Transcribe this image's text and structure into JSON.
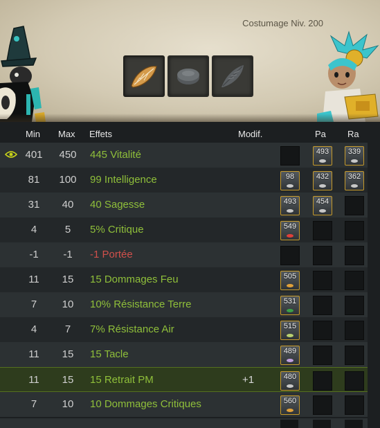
{
  "banner": {
    "title": "Costumage Niv. 200"
  },
  "slots": [
    {
      "icon": "rune-leaf-icon",
      "active": true
    },
    {
      "icon": "stone-icon",
      "active": false
    },
    {
      "icon": "feather-icon",
      "active": false
    }
  ],
  "headers": {
    "min": "Min",
    "max": "Max",
    "effects": "Effets",
    "modif": "Modif.",
    "pa": "Pa",
    "ra": "Ra"
  },
  "rows": [
    {
      "min": "401",
      "max": "450",
      "effect": "445 Vitalité",
      "color": "green",
      "modif": "",
      "eye": true,
      "r1": {
        "num": "",
        "filled": false
      },
      "r2": {
        "num": "493",
        "filled": true,
        "gem": "#c8c8c8"
      },
      "r3": {
        "num": "339",
        "filled": true,
        "gem": "#c8c8c8"
      }
    },
    {
      "min": "81",
      "max": "100",
      "effect": "99 Intelligence",
      "color": "green",
      "modif": "",
      "eye": false,
      "r1": {
        "num": "98",
        "filled": true,
        "gem": "#c8c8c8"
      },
      "r2": {
        "num": "432",
        "filled": true,
        "gem": "#c8c8c8"
      },
      "r3": {
        "num": "362",
        "filled": true,
        "gem": "#c8c8c8"
      }
    },
    {
      "min": "31",
      "max": "40",
      "effect": "40 Sagesse",
      "color": "green",
      "modif": "",
      "eye": false,
      "r1": {
        "num": "493",
        "filled": true,
        "gem": "#c8c8c8"
      },
      "r2": {
        "num": "454",
        "filled": true,
        "gem": "#c8c8c8"
      },
      "r3": {
        "num": "",
        "filled": false
      }
    },
    {
      "min": "4",
      "max": "5",
      "effect": "5% Critique",
      "color": "green",
      "modif": "",
      "eye": false,
      "r1": {
        "num": "549",
        "filled": true,
        "gem": "#e0403a"
      },
      "r2": {
        "num": "",
        "filled": false
      },
      "r3": {
        "num": "",
        "filled": false
      }
    },
    {
      "min": "-1",
      "max": "-1",
      "effect": "-1 Portée",
      "color": "red",
      "modif": "",
      "eye": false,
      "r1": {
        "num": "",
        "filled": false
      },
      "r2": {
        "num": "",
        "filled": false
      },
      "r3": {
        "num": "",
        "filled": false
      }
    },
    {
      "min": "11",
      "max": "15",
      "effect": "15 Dommages Feu",
      "color": "green",
      "modif": "",
      "eye": false,
      "r1": {
        "num": "505",
        "filled": true,
        "gem": "#e0a03a"
      },
      "r2": {
        "num": "",
        "filled": false
      },
      "r3": {
        "num": "",
        "filled": false
      }
    },
    {
      "min": "7",
      "max": "10",
      "effect": "10% Résistance Terre",
      "color": "green",
      "modif": "",
      "eye": false,
      "r1": {
        "num": "531",
        "filled": true,
        "gem": "#3aa048"
      },
      "r2": {
        "num": "",
        "filled": false
      },
      "r3": {
        "num": "",
        "filled": false
      }
    },
    {
      "min": "4",
      "max": "7",
      "effect": "7% Résistance Air",
      "color": "green",
      "modif": "",
      "eye": false,
      "r1": {
        "num": "515",
        "filled": true,
        "gem": "#b8d070"
      },
      "r2": {
        "num": "",
        "filled": false
      },
      "r3": {
        "num": "",
        "filled": false
      }
    },
    {
      "min": "11",
      "max": "15",
      "effect": "15 Tacle",
      "color": "green",
      "modif": "",
      "eye": false,
      "r1": {
        "num": "489",
        "filled": true,
        "gem": "#c0a0e0"
      },
      "r2": {
        "num": "",
        "filled": false
      },
      "r3": {
        "num": "",
        "filled": false
      }
    },
    {
      "min": "11",
      "max": "15",
      "effect": "15 Retrait PM",
      "color": "green",
      "modif": "+1",
      "eye": false,
      "highlight": true,
      "r1": {
        "num": "480",
        "filled": true,
        "gem": "#c8c8c8"
      },
      "r2": {
        "num": "",
        "filled": false
      },
      "r3": {
        "num": "",
        "filled": false
      }
    },
    {
      "min": "7",
      "max": "10",
      "effect": "10 Dommages Critiques",
      "color": "green",
      "modif": "",
      "eye": false,
      "r1": {
        "num": "560",
        "filled": true,
        "gem": "#e0a03a"
      },
      "r2": {
        "num": "",
        "filled": false
      },
      "r3": {
        "num": "",
        "filled": false
      }
    }
  ]
}
